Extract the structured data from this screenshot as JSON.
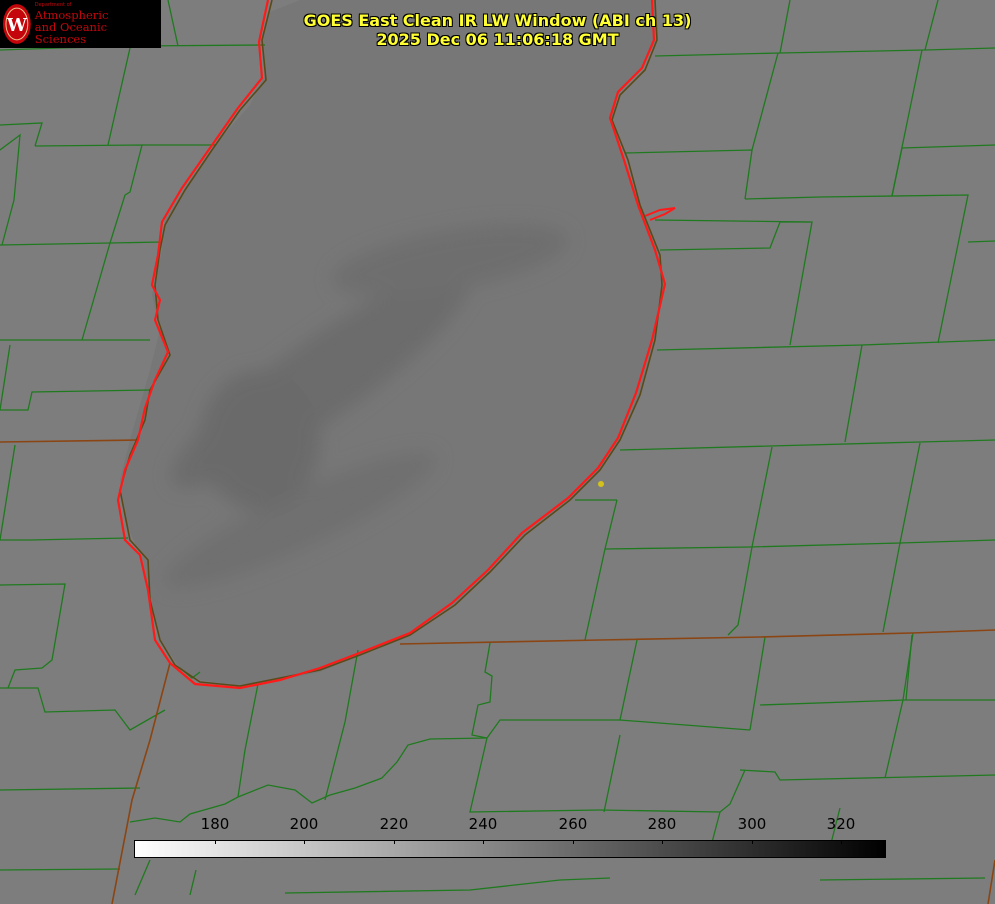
{
  "logo": {
    "dept": "Department of",
    "line1": "Atmospheric",
    "line2": "and Oceanic Sciences",
    "seal_letter": "W",
    "seal_color": "#c5050c",
    "text_color": "#c5050c"
  },
  "title": {
    "line1": "GOES East Clean IR LW Window (ABI ch 13)",
    "line2": "2025 Dec 06 11:06:18 GMT"
  },
  "colorbar": {
    "ticks": [
      "180",
      "200",
      "220",
      "240",
      "260",
      "280",
      "300",
      "320"
    ],
    "gradient_start": "#ffffff",
    "gradient_end": "#000000"
  },
  "colors": {
    "background": "#7d7d7d",
    "county_lines": "#1f7a1f",
    "state_lines": "#8b4513",
    "lake_outline": "#ff1a1a",
    "title": "#ffff33",
    "marker": "#d4c21a"
  }
}
